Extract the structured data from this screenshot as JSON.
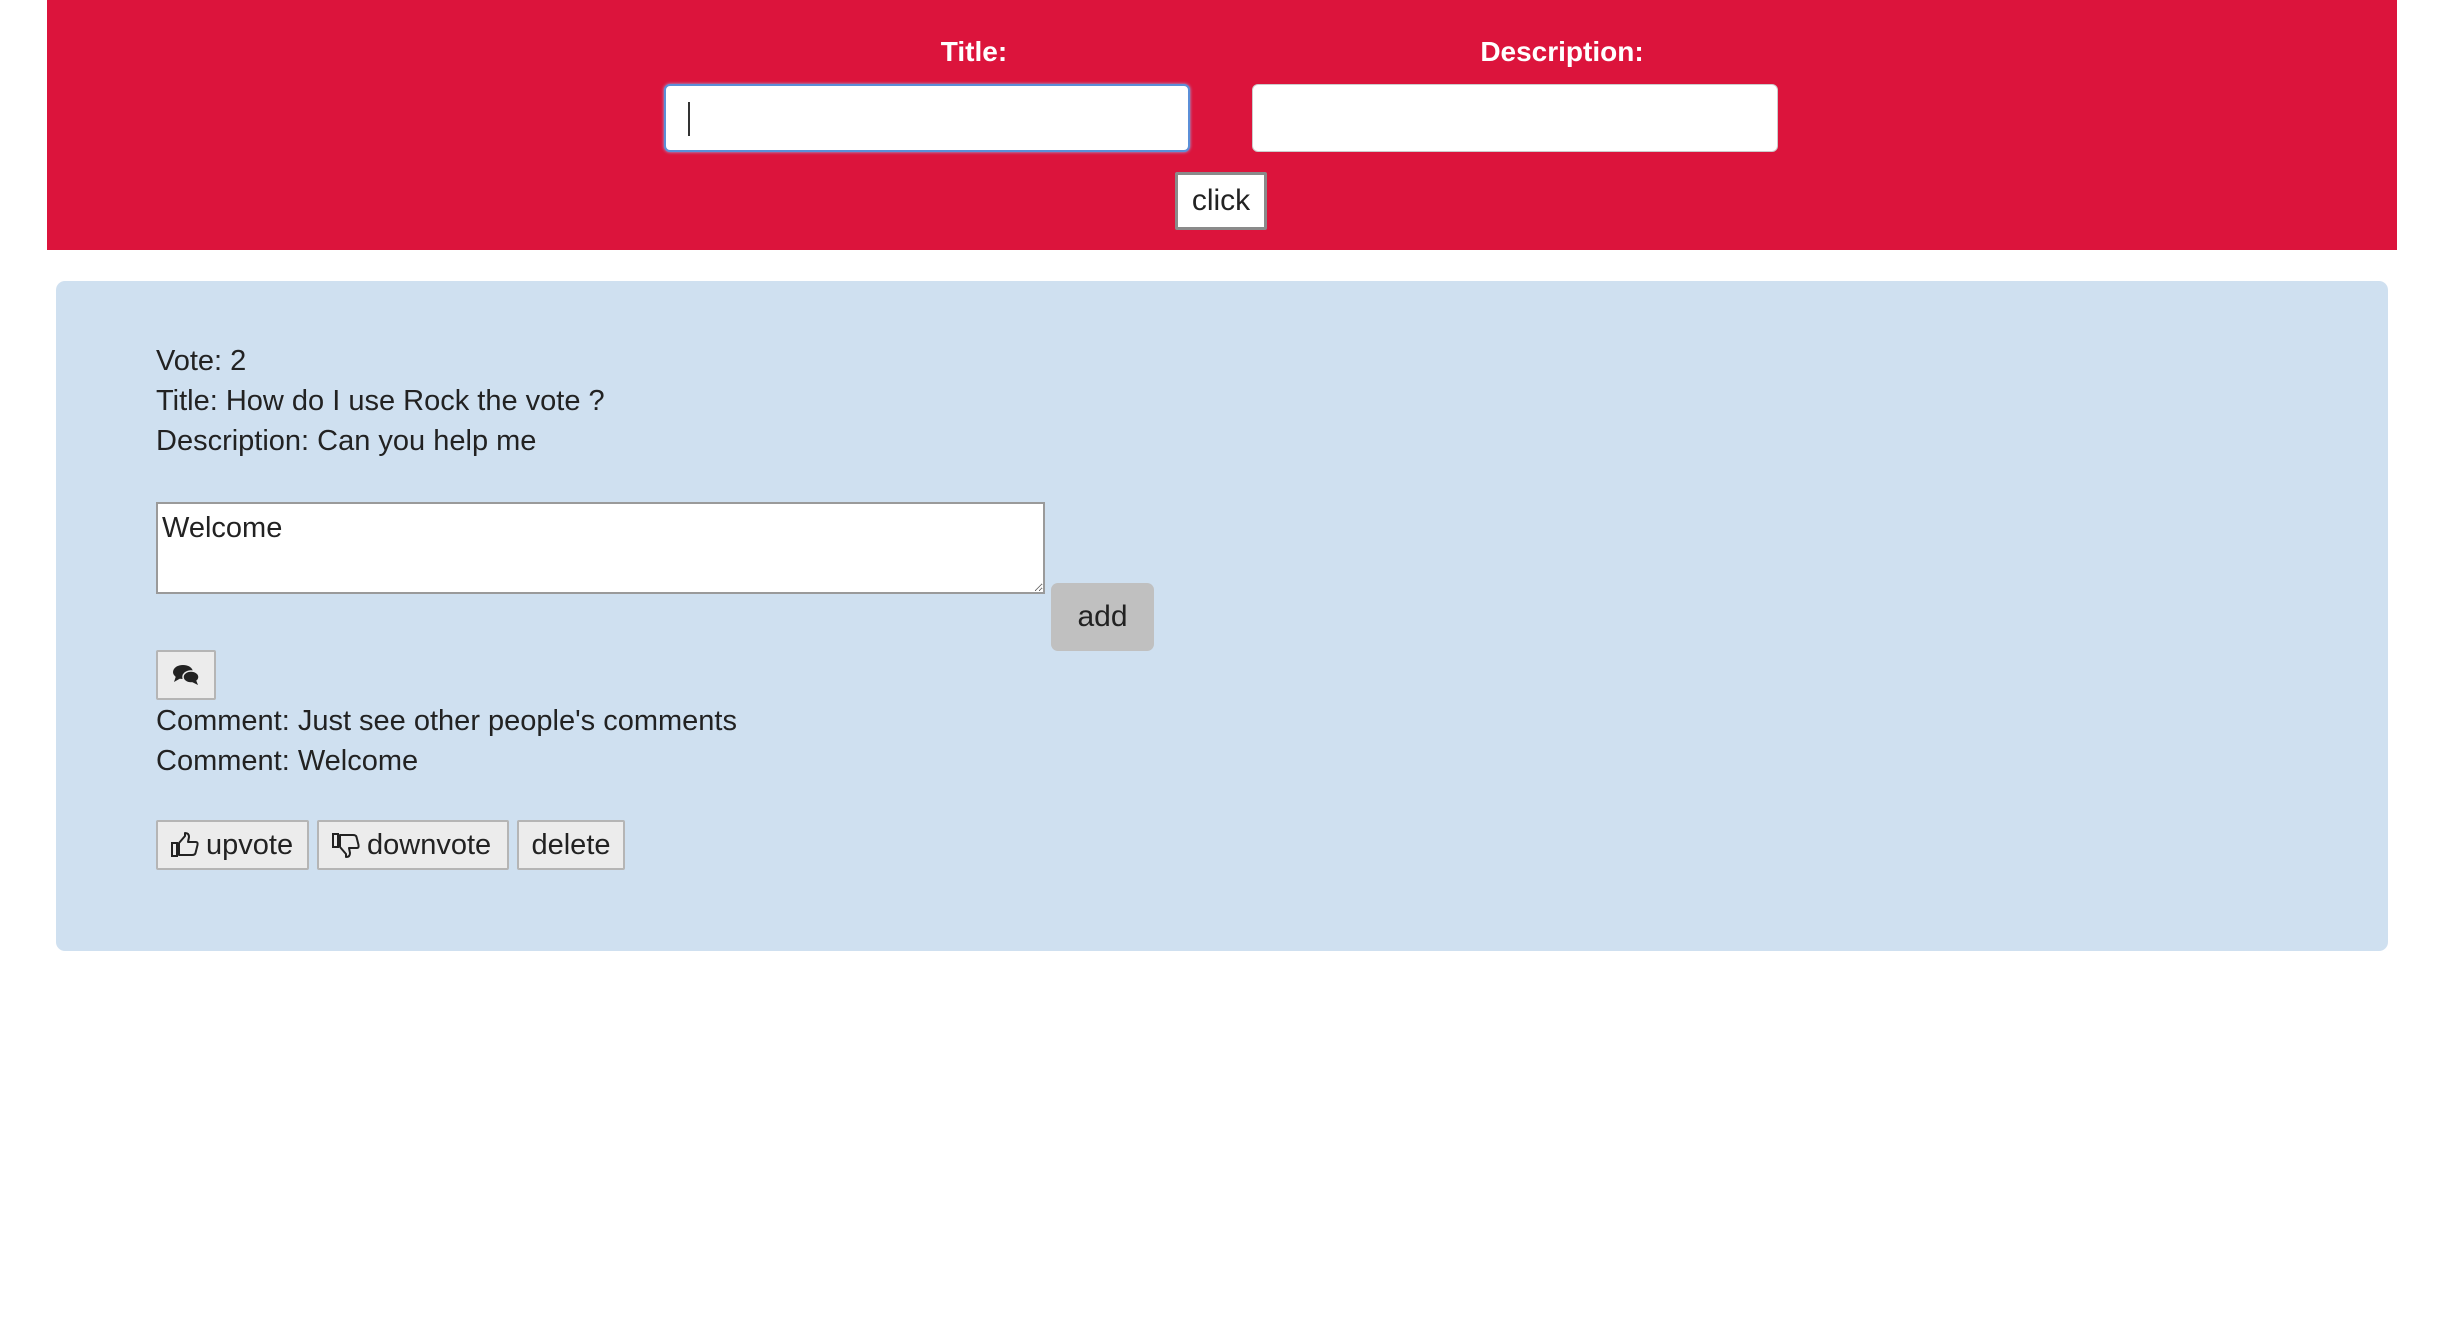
{
  "form": {
    "title_label": "Title:",
    "description_label": "Description:",
    "title_value": "",
    "description_value": "",
    "submit_label": "click"
  },
  "post": {
    "vote_text": "Vote: 2",
    "title_text": "Title: How do I use Rock the vote ?",
    "description_text": "Description: Can you help me",
    "comment_input_value": "Welcome",
    "add_label": "add",
    "comments_toggle_icon": "comments-icon",
    "comments": [
      "Comment: Just see other people's comments",
      "Comment: Welcome"
    ],
    "upvote_label": "upvote",
    "downvote_label": "downvote",
    "delete_label": "delete",
    "upvote_icon": "thumbs-up-icon",
    "downvote_icon": "thumbs-down-icon"
  },
  "colors": {
    "header_background": "#dc143c",
    "card_background": "#cfe0f0",
    "focus_border": "#5b8fd8"
  }
}
